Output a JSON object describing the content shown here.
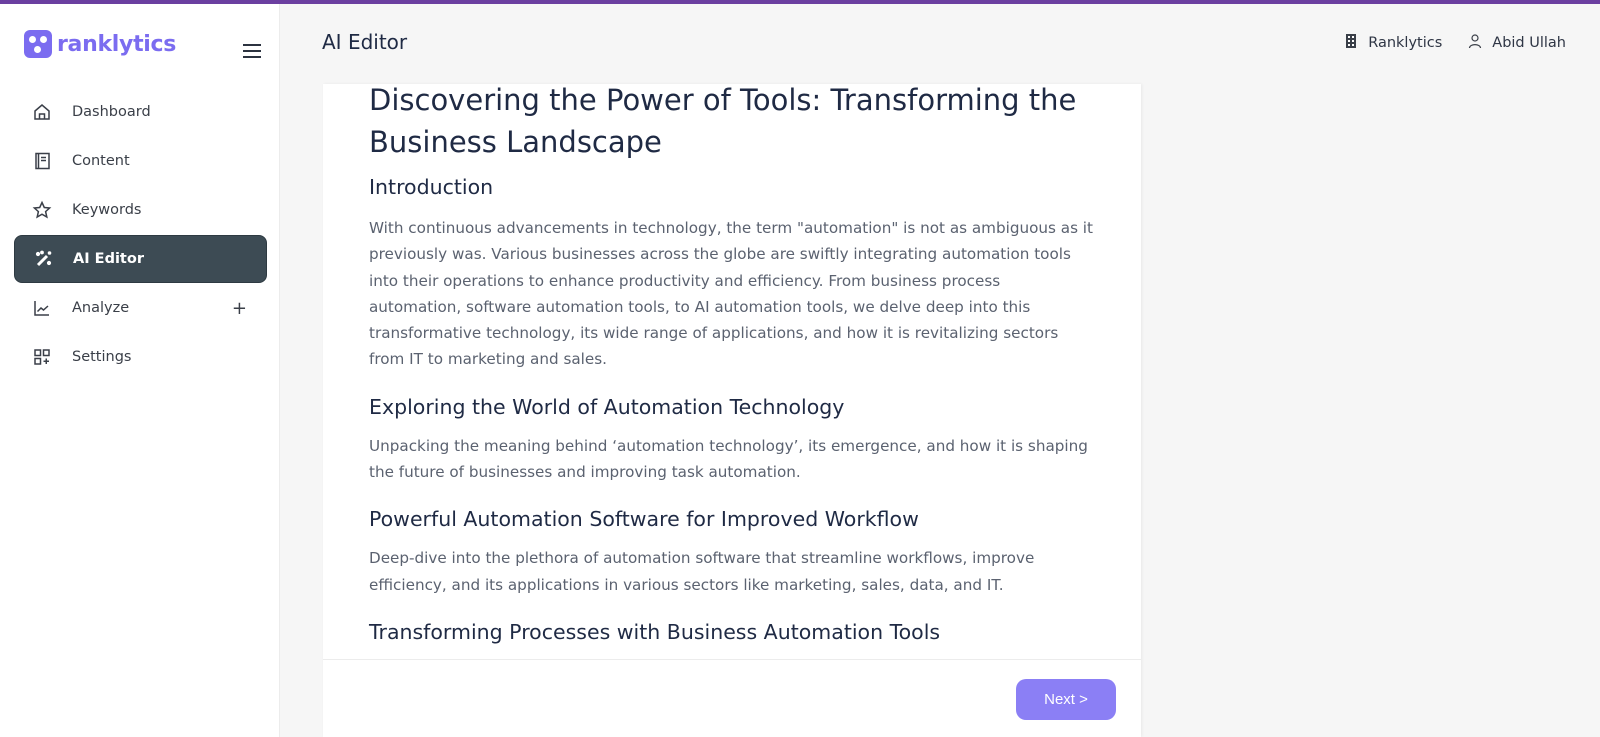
{
  "app": {
    "brand": "ranklytics",
    "accent_color": "#7b6cf0",
    "top_bar_color": "#6b3fa0"
  },
  "sidebar": {
    "items": [
      {
        "label": "Dashboard",
        "icon": "home-icon",
        "active": false
      },
      {
        "label": "Content",
        "icon": "document-icon",
        "active": false
      },
      {
        "label": "Keywords",
        "icon": "star-icon",
        "active": false
      },
      {
        "label": "AI Editor",
        "icon": "magic-wand-icon",
        "active": true
      },
      {
        "label": "Analyze",
        "icon": "chart-line-icon",
        "active": false,
        "expand": "+"
      },
      {
        "label": "Settings",
        "icon": "grid-plus-icon",
        "active": false
      }
    ]
  },
  "header": {
    "title": "AI Editor",
    "workspace": "Ranklytics",
    "user": "Abid Ullah"
  },
  "editor": {
    "title": "Discovering the Power of Tools: Transforming the Business Landscape",
    "sections": [
      {
        "heading": "Introduction",
        "body": "With continuous advancements in technology, the term \"automation\" is not as ambiguous as it previously was. Various businesses across the globe are swiftly integrating automation tools into their operations to enhance productivity and efficiency. From business process automation, software automation tools, to AI automation tools, we delve deep into this transformative technology, its wide range of applications, and how it is revitalizing sectors from IT to marketing and sales."
      },
      {
        "heading": "Exploring the World of Automation Technology",
        "body": "Unpacking the meaning behind ‘automation technology’, its emergence, and how it is shaping the future of businesses and improving task automation."
      },
      {
        "heading": "Powerful Automation Software for Improved Workflow",
        "body": "Deep-dive into the plethora of automation software that streamline workflows, improve efficiency, and its applications in various sectors like marketing, sales, data, and IT."
      },
      {
        "heading": "Transforming Processes with Business Automation Tools",
        "body": ""
      }
    ],
    "next_label": "Next >"
  }
}
